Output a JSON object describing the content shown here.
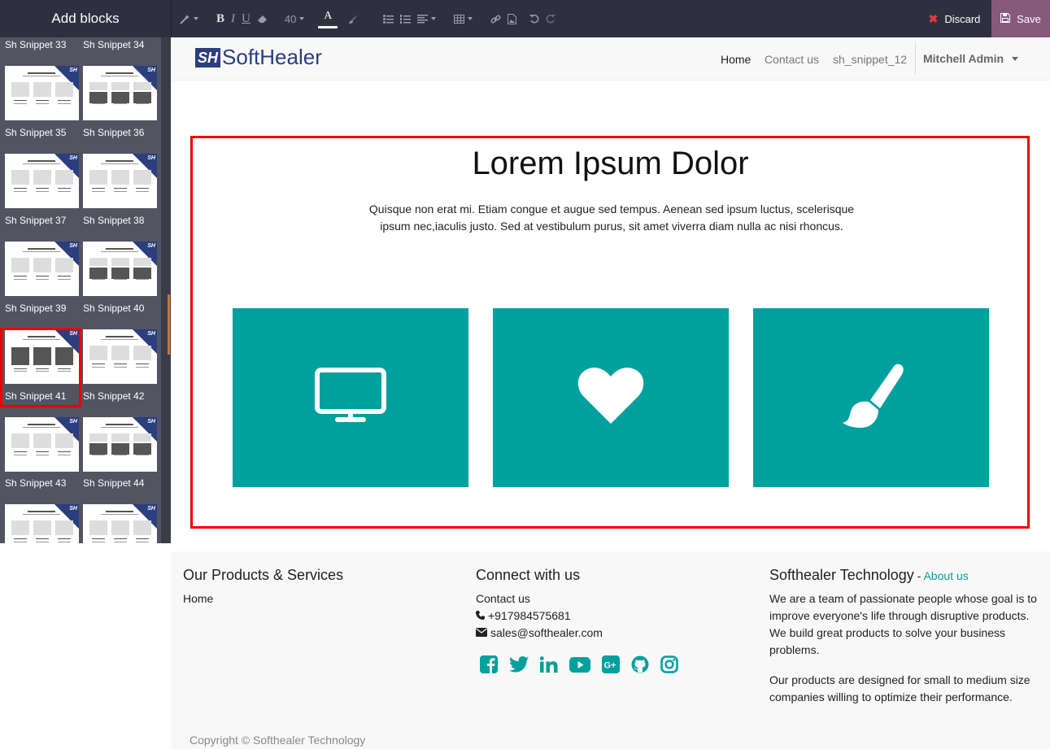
{
  "editor": {
    "add_blocks_title": "Add blocks",
    "font_size": "40",
    "font_color_glyph": "A",
    "bold_glyph": "B",
    "italic_glyph": "I",
    "underline_glyph": "U",
    "discard_label": "Discard",
    "save_label": "Save"
  },
  "sidebar": {
    "brand_mark": "SH",
    "snippets": [
      {
        "label": "Sh Snippet 33"
      },
      {
        "label": "Sh Snippet 34"
      },
      {
        "label": "Sh Snippet 35"
      },
      {
        "label": "Sh Snippet 36"
      },
      {
        "label": "Sh Snippet 37"
      },
      {
        "label": "Sh Snippet 38"
      },
      {
        "label": "Sh Snippet 39"
      },
      {
        "label": "Sh Snippet 40"
      },
      {
        "label": "Sh Snippet 41",
        "selected": true
      },
      {
        "label": "Sh Snippet 42"
      },
      {
        "label": "Sh Snippet 43"
      },
      {
        "label": "Sh Snippet 44"
      }
    ]
  },
  "navbar": {
    "logo_mark": "SH",
    "logo_text": "SoftHealer",
    "menu": [
      {
        "label": "Home",
        "active": true
      },
      {
        "label": "Contact us"
      },
      {
        "label": "sh_snippet_12"
      }
    ],
    "user": "Mitchell Admin"
  },
  "hero": {
    "title": "Lorem Ipsum Dolor",
    "text": "Quisque non erat mi. Etiam congue et augue sed tempus. Aenean sed ipsum luctus, scelerisque ipsum nec,iaculis justo. Sed at vestibulum purus, sit amet viverra diam nulla ac nisi rhoncus.",
    "accent_color": "#00a09d",
    "cards": [
      {
        "icon": "monitor-icon"
      },
      {
        "icon": "heart-icon"
      },
      {
        "icon": "paintbrush-icon"
      }
    ]
  },
  "footer": {
    "col1": {
      "title": "Our Products & Services",
      "links": [
        "Home"
      ]
    },
    "col2": {
      "title": "Connect with us",
      "contact_link": "Contact us",
      "phone": "+917984575681",
      "email": "sales@softhealer.com",
      "social": [
        "facebook-icon",
        "twitter-icon",
        "linkedin-icon",
        "youtube-icon",
        "google-plus-icon",
        "github-icon",
        "instagram-icon"
      ]
    },
    "col3": {
      "title": "Softhealer Technology",
      "separator": " - ",
      "about_link": "About us",
      "para1": "We are a team of passionate people whose goal is to improve everyone's life through disruptive products. We build great products to solve your business problems.",
      "para2": "Our products are designed for small to medium size companies willing to optimize their performance."
    },
    "copyright": "Copyright © Softhealer Technology"
  }
}
